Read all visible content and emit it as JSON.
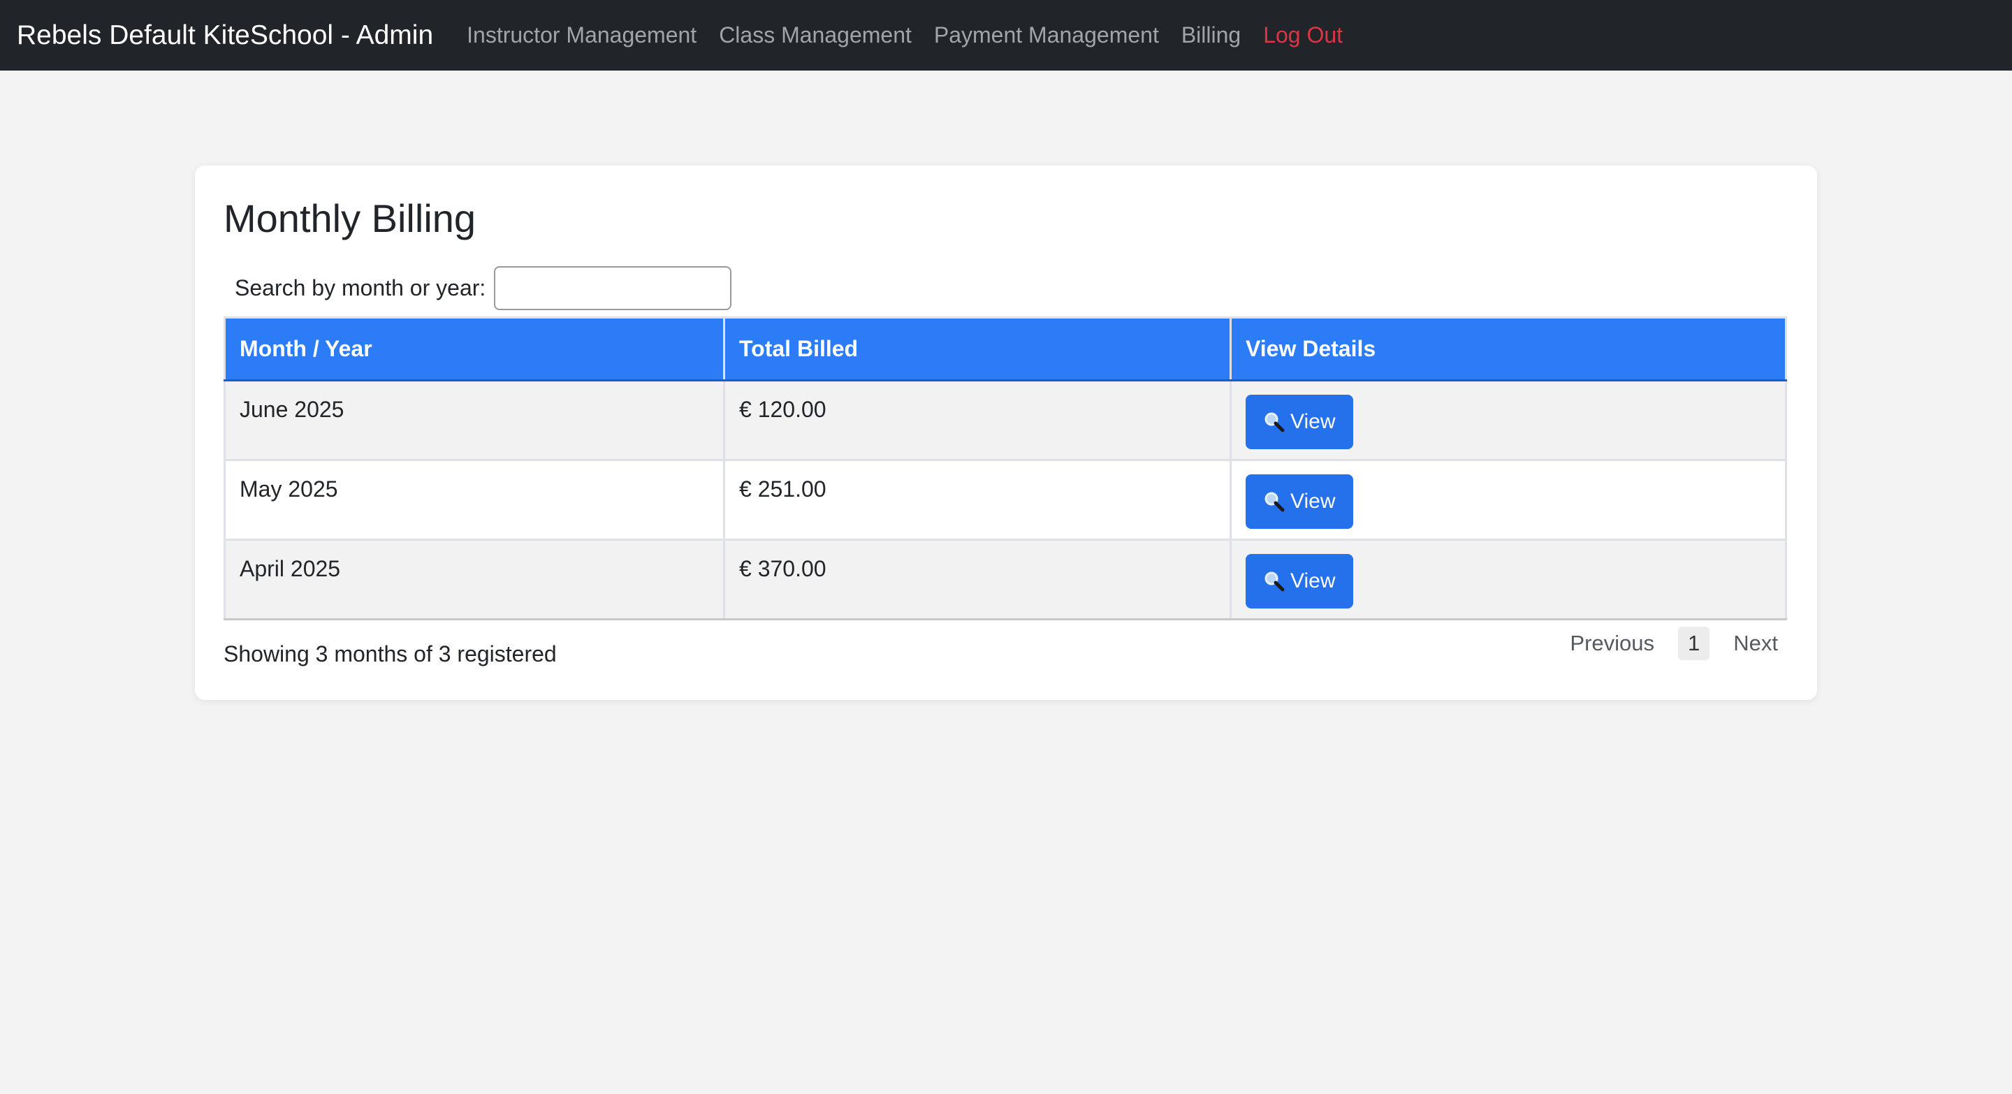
{
  "navbar": {
    "brand": "Rebels Default KiteSchool - Admin",
    "links": [
      {
        "label": "Instructor Management"
      },
      {
        "label": "Class Management"
      },
      {
        "label": "Payment Management"
      },
      {
        "label": "Billing"
      },
      {
        "label": "Log Out",
        "color": "#dc3545"
      }
    ]
  },
  "main": {
    "title": "Monthly Billing",
    "search": {
      "label": "Search by month or year:",
      "value": "",
      "placeholder": ""
    },
    "table": {
      "headers": [
        "Month / Year",
        "Total Billed",
        "View Details"
      ],
      "rows": [
        {
          "month": "June 2025",
          "total": "€ 120.00",
          "action": "View",
          "icon": "magnifier-icon"
        },
        {
          "month": "May 2025",
          "total": "€ 251.00",
          "action": "View",
          "icon": "magnifier-icon"
        },
        {
          "month": "April 2025",
          "total": "€ 370.00",
          "action": "View",
          "icon": "magnifier-icon"
        }
      ]
    },
    "summary": "Showing 3 months of 3 registered",
    "pagination": {
      "previous": "Previous",
      "current": "1",
      "next": "Next"
    }
  },
  "colors": {
    "navbar_bg": "#212529",
    "header_blue": "#2b7cf6",
    "button_blue": "#2570eb",
    "logout_red": "#dc3545"
  }
}
